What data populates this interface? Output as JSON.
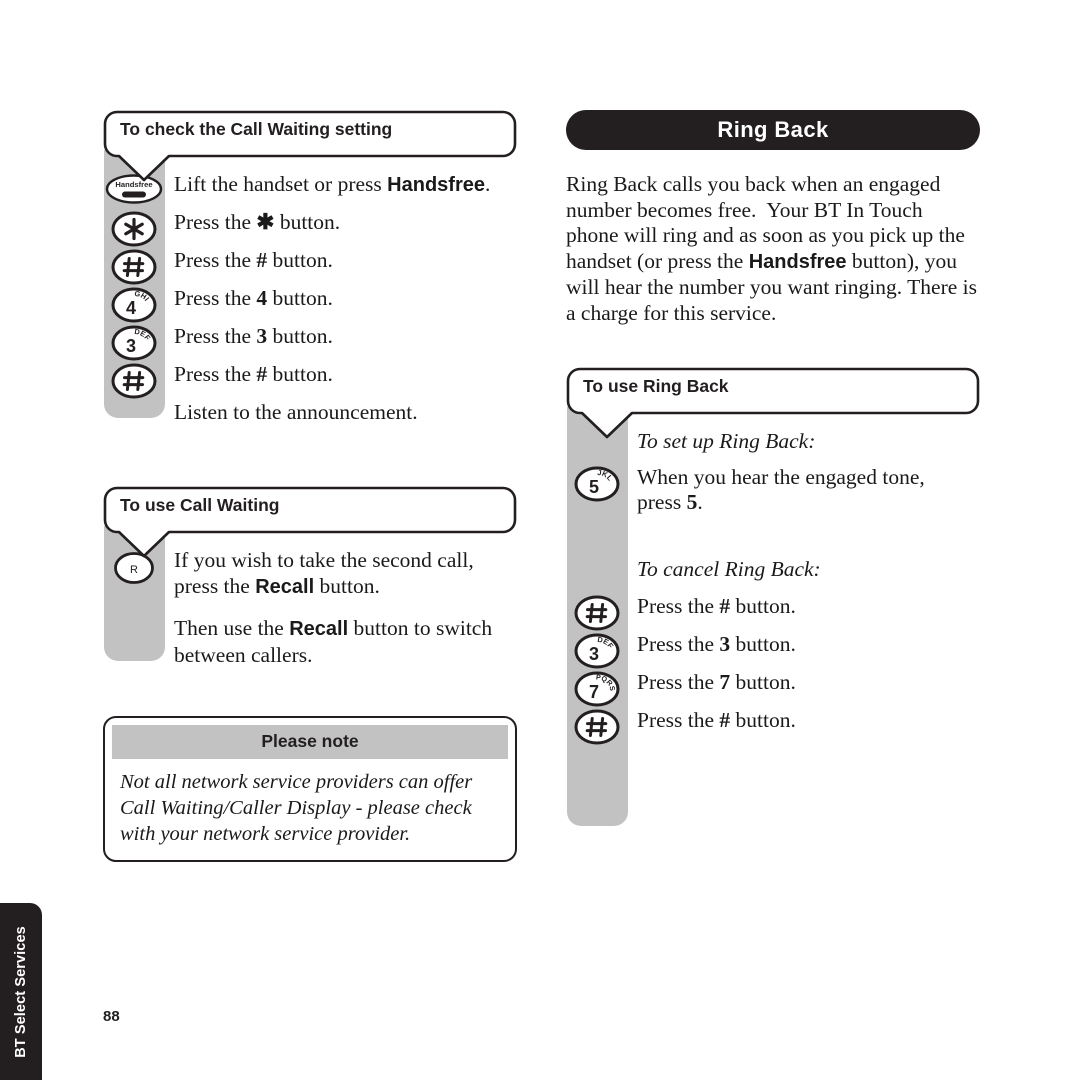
{
  "page": {
    "number": "88",
    "side_tab_label": "BT Select Services",
    "colors": {
      "ink": "#231f20",
      "key_column_gray": "#c2c2c2",
      "banner_background": "#231f20",
      "banner_text": "#ffffff",
      "paper": "#ffffff"
    }
  },
  "left_column": {
    "sections": [
      {
        "callout_title": "To check the Call Waiting setting",
        "steps": [
          {
            "key": "handsfree-key",
            "key_label": "Handsfree",
            "key_letters": "",
            "text_parts": [
              {
                "t": "Lift the handset or press ",
                "style": "normal"
              },
              {
                "t": "Handsfree",
                "style": "sans-bold"
              },
              {
                "t": ".",
                "style": "normal"
              }
            ]
          },
          {
            "key": "star-key",
            "key_label": "✱",
            "key_letters": "",
            "text_parts": [
              {
                "t": "Press the ",
                "style": "normal"
              },
              {
                "t": "✱",
                "style": "sym"
              },
              {
                "t": " button.",
                "style": "normal"
              }
            ]
          },
          {
            "key": "hash-key",
            "key_label": "#",
            "key_letters": "",
            "text_parts": [
              {
                "t": "Press the ",
                "style": "normal"
              },
              {
                "t": "#",
                "style": "sym"
              },
              {
                "t": " button.",
                "style": "normal"
              }
            ]
          },
          {
            "key": "digit-key-4",
            "key_label": "4",
            "key_letters": "GHI",
            "text_parts": [
              {
                "t": "Press the ",
                "style": "normal"
              },
              {
                "t": "4",
                "style": "sym"
              },
              {
                "t": " button.",
                "style": "normal"
              }
            ]
          },
          {
            "key": "digit-key-3",
            "key_label": "3",
            "key_letters": "DEF",
            "text_parts": [
              {
                "t": "Press the ",
                "style": "normal"
              },
              {
                "t": "3",
                "style": "sym"
              },
              {
                "t": " button.",
                "style": "normal"
              }
            ]
          },
          {
            "key": "hash-key",
            "key_label": "#",
            "key_letters": "",
            "text_parts": [
              {
                "t": "Press the ",
                "style": "normal"
              },
              {
                "t": "#",
                "style": "sym"
              },
              {
                "t": " button.",
                "style": "normal"
              }
            ]
          },
          {
            "key": "none",
            "key_label": "",
            "key_letters": "",
            "text_parts": [
              {
                "t": "Listen to the announcement.",
                "style": "normal"
              }
            ]
          }
        ]
      },
      {
        "callout_title": "To use Call Waiting",
        "steps": [
          {
            "key": "recall-key",
            "key_label": "R",
            "key_letters": "",
            "text_parts": [
              {
                "t": "If you wish to take the second call, press the ",
                "style": "normal"
              },
              {
                "t": "Recall",
                "style": "sans-bold"
              },
              {
                "t": " button.",
                "style": "normal"
              }
            ]
          },
          {
            "key": "none",
            "key_label": "",
            "key_letters": "",
            "text_parts": [
              {
                "t": "Then use the ",
                "style": "normal"
              },
              {
                "t": "Recall",
                "style": "sans-bold"
              },
              {
                "t": " button to switch between callers.",
                "style": "normal"
              }
            ]
          }
        ]
      }
    ],
    "note": {
      "heading": "Please note",
      "body": "Not all network service providers can offer Call Waiting/Caller Display - please check with your network service provider."
    }
  },
  "right_column": {
    "banner_title": "Ring Back",
    "intro_parts": [
      {
        "t": "Ring Back calls you back when an engaged number becomes free.  Your BT In Touch phone will ring and as soon as you pick up the handset (or press the ",
        "style": "normal"
      },
      {
        "t": "Handsfree",
        "style": "sans-bold"
      },
      {
        "t": " button), you will hear the number you want ringing. There is a charge for this service.",
        "style": "normal"
      }
    ],
    "section": {
      "callout_title": "To use Ring Back",
      "subheading_setup": "To set up Ring Back:",
      "subheading_cancel": "To cancel Ring Back:",
      "setup_steps": [
        {
          "key": "digit-key-5",
          "key_label": "5",
          "key_letters": "JKL",
          "text_parts": [
            {
              "t": "When you hear the engaged tone, press ",
              "style": "normal"
            },
            {
              "t": "5",
              "style": "sym"
            },
            {
              "t": ".",
              "style": "normal"
            }
          ]
        }
      ],
      "cancel_steps": [
        {
          "key": "hash-key",
          "key_label": "#",
          "key_letters": "",
          "text_parts": [
            {
              "t": "Press the ",
              "style": "normal"
            },
            {
              "t": "#",
              "style": "sym"
            },
            {
              "t": " button.",
              "style": "normal"
            }
          ]
        },
        {
          "key": "digit-key-3",
          "key_label": "3",
          "key_letters": "DEF",
          "text_parts": [
            {
              "t": "Press the ",
              "style": "normal"
            },
            {
              "t": "3",
              "style": "sym"
            },
            {
              "t": " button.",
              "style": "normal"
            }
          ]
        },
        {
          "key": "digit-key-7",
          "key_label": "7",
          "key_letters": "PQRS",
          "text_parts": [
            {
              "t": "Press the ",
              "style": "normal"
            },
            {
              "t": "7",
              "style": "sym"
            },
            {
              "t": " button.",
              "style": "normal"
            }
          ]
        },
        {
          "key": "hash-key",
          "key_label": "#",
          "key_letters": "",
          "text_parts": [
            {
              "t": "Press the ",
              "style": "normal"
            },
            {
              "t": "#",
              "style": "sym"
            },
            {
              "t": " button.",
              "style": "normal"
            }
          ]
        }
      ]
    }
  }
}
